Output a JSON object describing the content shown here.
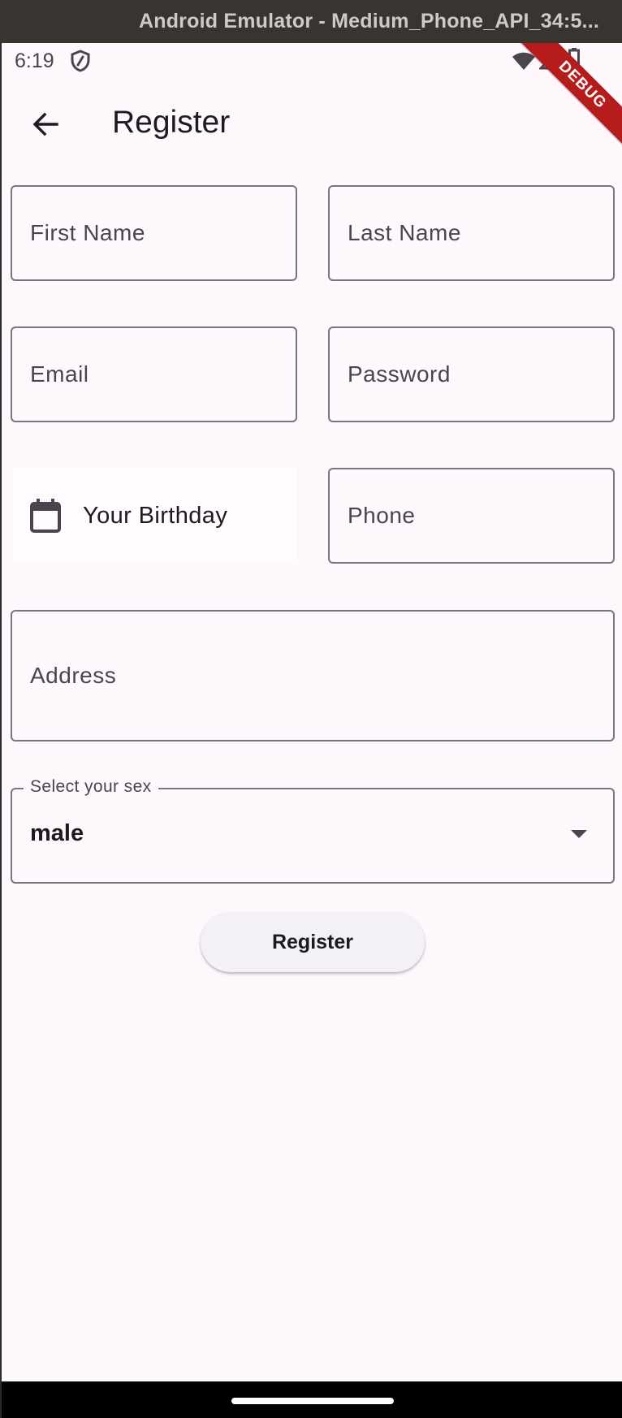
{
  "window": {
    "title": "Android Emulator - Medium_Phone_API_34:5..."
  },
  "status_bar": {
    "time": "6:19",
    "icons": [
      "shield-icon",
      "wifi-icon",
      "signal-icon",
      "battery-icon"
    ]
  },
  "debug_banner": "DEBUG",
  "app_bar": {
    "title": "Register",
    "back_icon": "arrow-back-icon"
  },
  "form": {
    "first_name": {
      "placeholder": "First Name",
      "value": ""
    },
    "last_name": {
      "placeholder": "Last Name",
      "value": ""
    },
    "email": {
      "placeholder": "Email",
      "value": ""
    },
    "password": {
      "placeholder": "Password",
      "value": ""
    },
    "birthday": {
      "label": "Your Birthday",
      "icon": "calendar-icon"
    },
    "phone": {
      "placeholder": "Phone",
      "value": ""
    },
    "address": {
      "placeholder": "Address",
      "value": ""
    },
    "sex": {
      "label": "Select your sex",
      "value": "male"
    },
    "submit_label": "Register"
  },
  "colors": {
    "background": "#fef7fc",
    "outline": "#79747e",
    "text": "#1d1b20",
    "debug": "#b71c1c"
  }
}
